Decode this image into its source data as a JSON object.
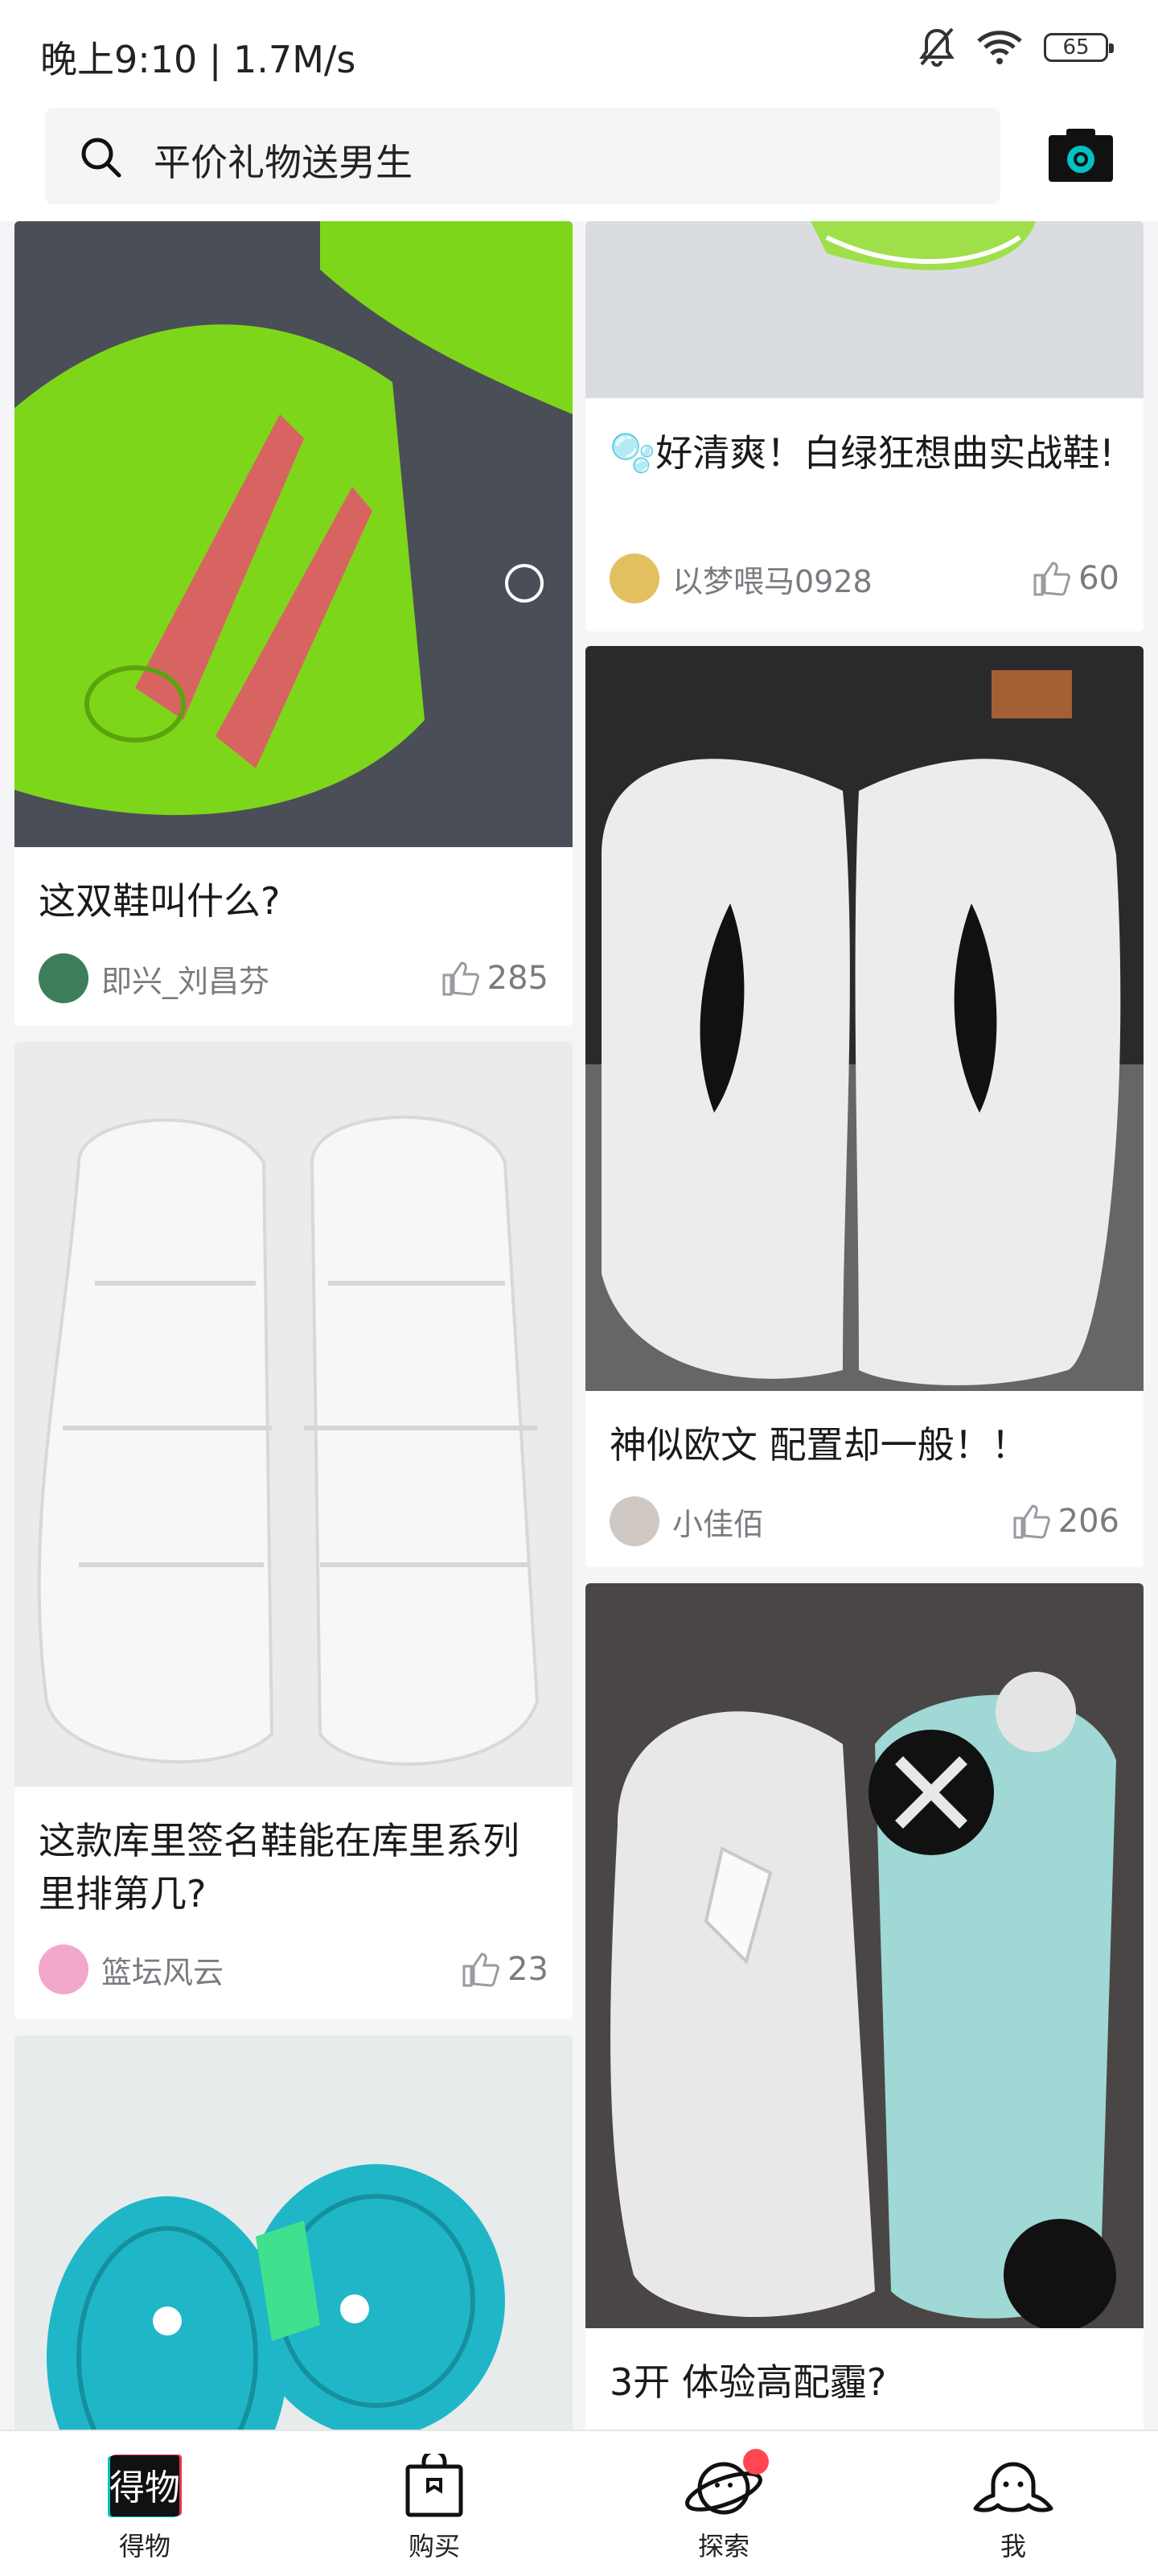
{
  "status_bar": {
    "time": "晚上9:10 | 1.7M/s",
    "battery": "65"
  },
  "search": {
    "placeholder": "平价礼物送男生"
  },
  "colors": {
    "accent": "#01c2c3",
    "badge": "#ff4651",
    "text_gray": "#7a7a80"
  },
  "feed": {
    "left": [
      {
        "title": "这双鞋叫什么?",
        "author": "即兴_刘昌芬",
        "likes": "285"
      },
      {
        "title": "这款库里签名鞋能在库里系列里排第几?",
        "author": "篮坛风云",
        "likes": "23"
      }
    ],
    "right": [
      {
        "title": "🫧好清爽！白绿狂想曲实战鞋!",
        "author": "以梦喂马0928",
        "likes": "60"
      },
      {
        "title": "神似欧文 配置却一般！！",
        "author": "小佳佰",
        "likes": "206"
      },
      {
        "title": "3开 体验高配霾?"
      }
    ]
  },
  "tabbar": {
    "items": [
      {
        "label": "得物",
        "icon": "dewu-logo-icon"
      },
      {
        "label": "购买",
        "icon": "shopping-bag-icon"
      },
      {
        "label": "探索",
        "icon": "planet-icon"
      },
      {
        "label": "我",
        "icon": "profile-icon"
      }
    ]
  }
}
